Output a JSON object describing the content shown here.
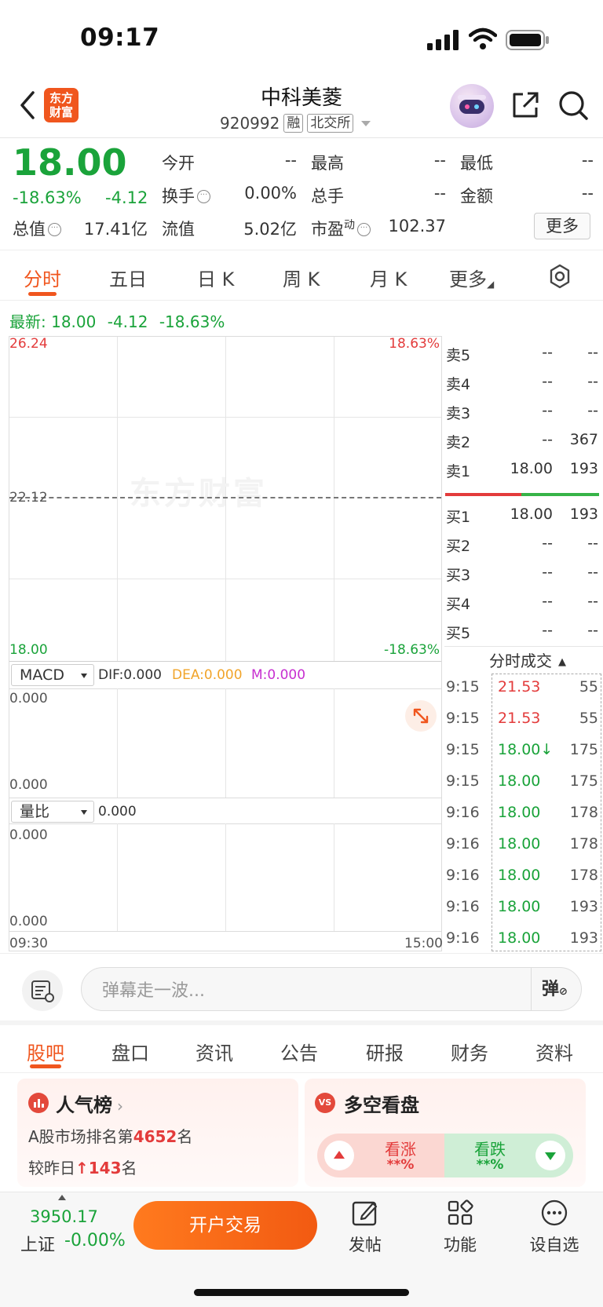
{
  "status": {
    "time": "09:17"
  },
  "header": {
    "logo_text_1": "东方",
    "logo_text_2": "财富",
    "title": "中科美菱",
    "code": "920992",
    "tag_margin": "融",
    "tag_exchange": "北交所"
  },
  "quote": {
    "price": "18.00",
    "change_pct": "-18.63%",
    "change": "-4.12",
    "fields": {
      "open_label": "今开",
      "open": "--",
      "high_label": "最高",
      "high": "--",
      "low_label": "最低",
      "low": "--",
      "turnover_label": "换手",
      "turnover": "0.00%",
      "volume_label": "总手",
      "volume": "--",
      "amount_label": "金额",
      "amount": "--",
      "mcap_label": "总值",
      "mcap": "17.41亿",
      "float_label": "流值",
      "float": "5.02亿",
      "pe_label": "市盈",
      "pe_sup": "动",
      "pe": "102.37"
    },
    "more": "更多",
    "colors": {
      "down": "#1aa33a",
      "up": "#e33b3b",
      "accent": "#f0561e"
    }
  },
  "tabs": {
    "items": [
      "分时",
      "五日",
      "日 K",
      "周 K",
      "月 K",
      "更多"
    ],
    "active": "分时"
  },
  "chart": {
    "latest_label": "最新:",
    "latest_price": "18.00",
    "latest_change": "-4.12",
    "latest_pct": "-18.63%",
    "y_top": "26.24",
    "y_top_pct": "18.63%",
    "y_mid": "22.12",
    "y_bottom": "18.00",
    "y_bottom_pct": "-18.63%",
    "watermark": "东方财富",
    "macd_sel": "MACD",
    "dif": "DIF:0.000",
    "dea": "DEA:0.000",
    "m": "M:0.000",
    "macd_top": "0.000",
    "macd_bottom": "0.000",
    "vol_sel": "量比",
    "vol_val": "0.000",
    "vol_top": "0.000",
    "vol_bottom": "0.000",
    "x_start": "09:30",
    "x_end": "15:00"
  },
  "orderbook": {
    "sells": [
      {
        "label": "卖5",
        "price": "--",
        "vol": "--"
      },
      {
        "label": "卖4",
        "price": "--",
        "vol": "--"
      },
      {
        "label": "卖3",
        "price": "--",
        "vol": "--"
      },
      {
        "label": "卖2",
        "price": "--",
        "vol": "367"
      },
      {
        "label": "卖1",
        "price": "18.00",
        "vol": "193"
      }
    ],
    "buys": [
      {
        "label": "买1",
        "price": "18.00",
        "vol": "193"
      },
      {
        "label": "买2",
        "price": "--",
        "vol": "--"
      },
      {
        "label": "买3",
        "price": "--",
        "vol": "--"
      },
      {
        "label": "买4",
        "price": "--",
        "vol": "--"
      },
      {
        "label": "买5",
        "price": "--",
        "vol": "--"
      }
    ],
    "trades_label": "分时成交",
    "trades": [
      {
        "time": "9:15",
        "price": "21.53",
        "vol": "55"
      },
      {
        "time": "9:15",
        "price": "21.53",
        "vol": "55"
      },
      {
        "time": "9:15",
        "price": "18.00↓",
        "vol": "175"
      },
      {
        "time": "9:15",
        "price": "18.00",
        "vol": "175"
      },
      {
        "time": "9:16",
        "price": "18.00",
        "vol": "178"
      },
      {
        "time": "9:16",
        "price": "18.00",
        "vol": "178"
      },
      {
        "time": "9:16",
        "price": "18.00",
        "vol": "178"
      },
      {
        "time": "9:16",
        "price": "18.00",
        "vol": "193"
      },
      {
        "time": "9:16",
        "price": "18.00",
        "vol": "193"
      }
    ]
  },
  "barrage": {
    "placeholder": "弹幕走一波...",
    "button": "弹"
  },
  "bottom_tabs": {
    "items": [
      "股吧",
      "盘口",
      "资讯",
      "公告",
      "研报",
      "财务",
      "资料"
    ],
    "active": "股吧"
  },
  "cards": {
    "popularity": {
      "title": "人气榜",
      "rank_prefix": "A股市场排名第",
      "rank": "4652",
      "rank_suffix": "名",
      "change_prefix": "较昨日",
      "change_arrow": "🠕",
      "change": "143",
      "change_suffix": "名"
    },
    "sentiment": {
      "icon": "VS",
      "title": "多空看盘",
      "bull_label": "看涨",
      "bull_val": "**%",
      "bear_label": "看跌",
      "bear_val": "**%"
    }
  },
  "nav": {
    "index_value": "3950.17",
    "index_name": "上证",
    "index_change": "-0.00%",
    "trade_btn": "开户交易",
    "post": "发帖",
    "func": "功能",
    "watch": "设自选"
  }
}
